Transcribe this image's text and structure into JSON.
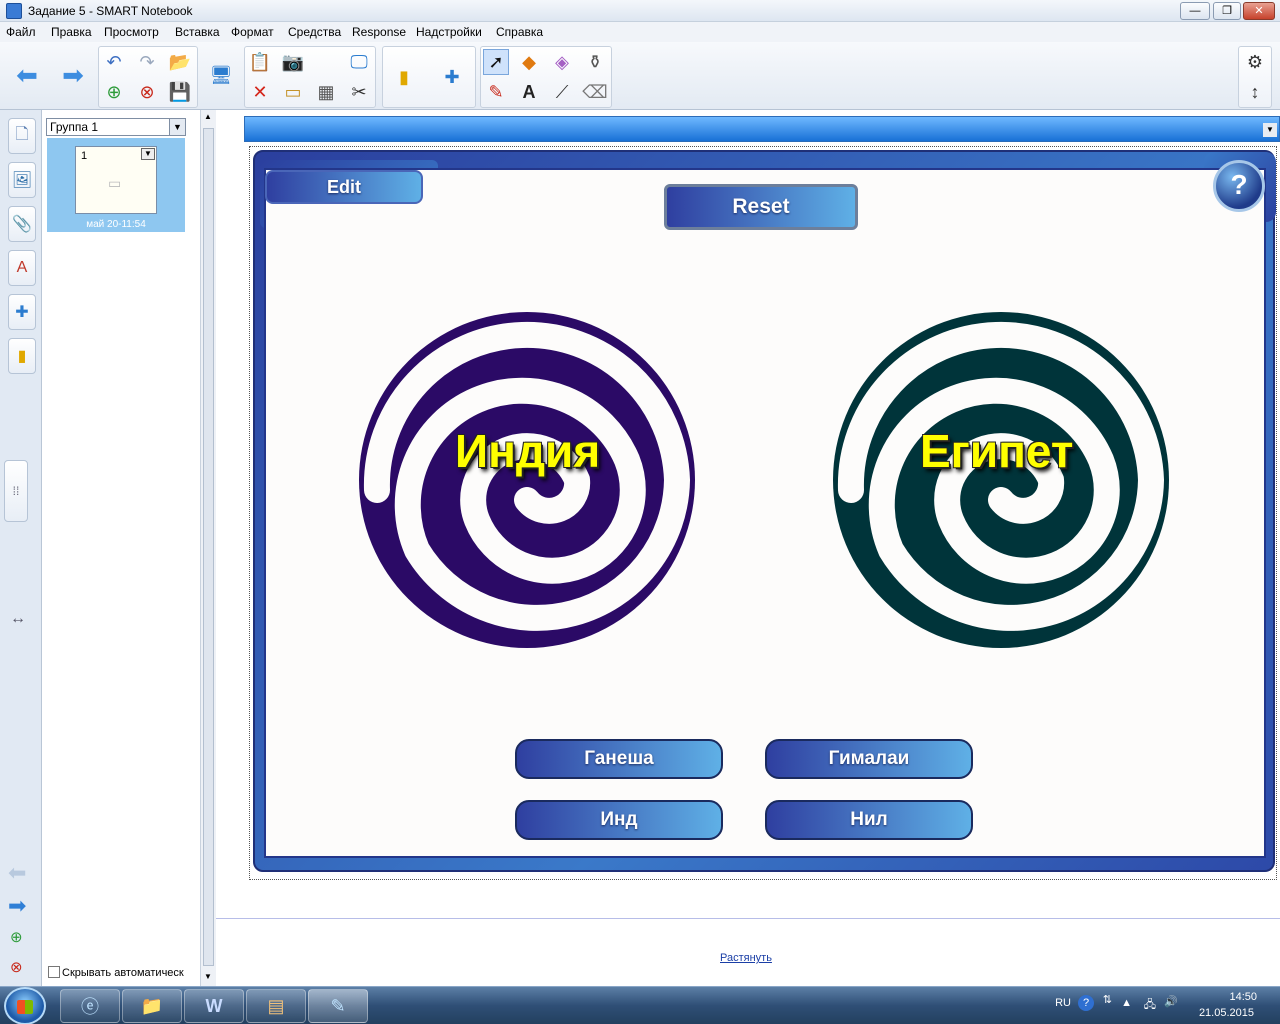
{
  "window": {
    "title": "Задание 5 - SMART Notebook"
  },
  "menu": [
    "Файл",
    "Правка",
    "Просмотр",
    "Вставка",
    "Формат",
    "Средства",
    "Response",
    "Надстройки",
    "Справка"
  ],
  "sorter": {
    "group": "Группа 1",
    "page_number": "1",
    "page_time": "май 20-11:54",
    "autohide_label": "Скрывать автоматическ"
  },
  "activity": {
    "edit_label": "Edit",
    "reset_label": "Reset",
    "help_label": "?",
    "categories": [
      {
        "label": "Индия",
        "color": "#2b0a66"
      },
      {
        "label": "Египет",
        "color": "#00343a"
      }
    ],
    "items": [
      "Ганеша",
      "Гималаи",
      "Инд",
      "Нил"
    ]
  },
  "canvas": {
    "stretch_link": "Растянуть"
  },
  "tray": {
    "lang": "RU",
    "time": "14:50",
    "date": "21.05.2015"
  },
  "colors": {
    "accent_blue": "#3d8de0",
    "pill_dark": "#2f3fa0",
    "pill_light": "#5fb0e6",
    "label_yellow": "#ffff00"
  }
}
